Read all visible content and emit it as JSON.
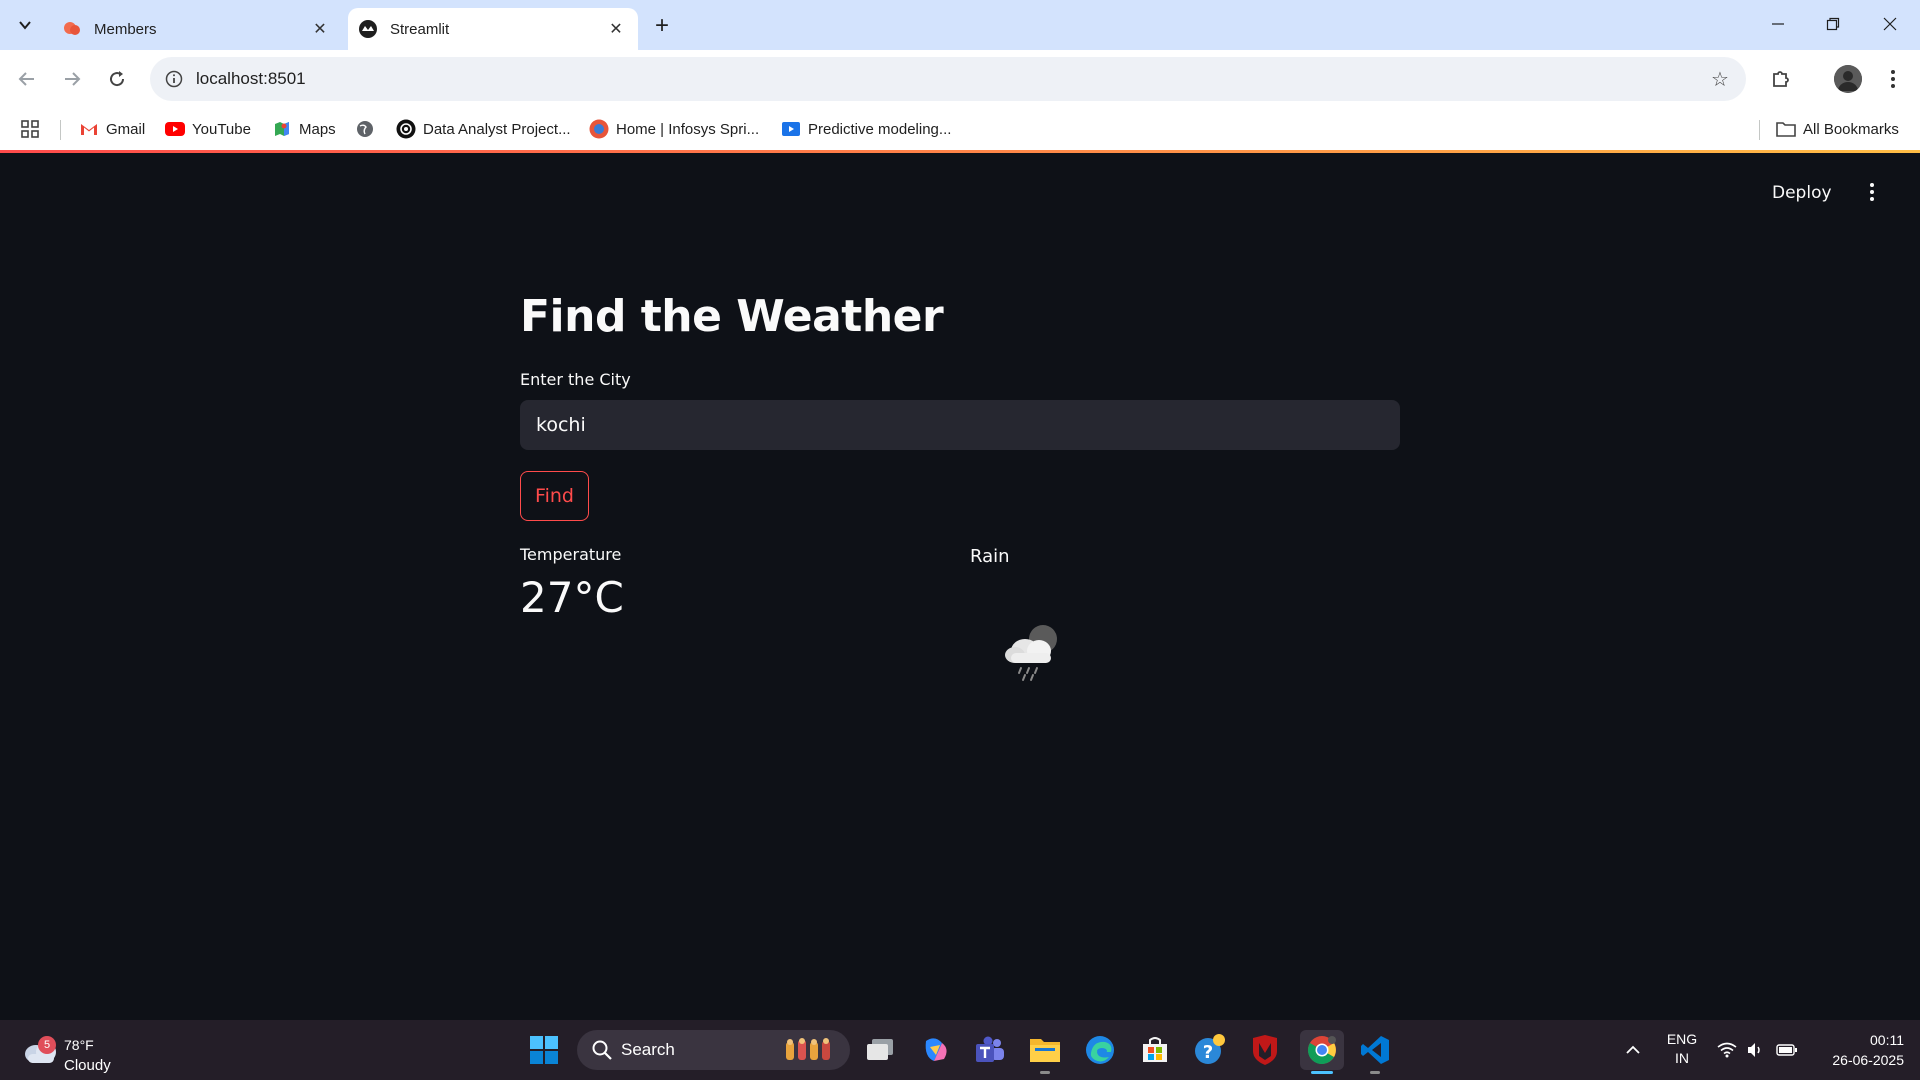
{
  "browser": {
    "tabs": [
      {
        "title": "Members"
      },
      {
        "title": "Streamlit"
      }
    ],
    "url": "localhost:8501",
    "bookmarks": [
      {
        "label": "Gmail"
      },
      {
        "label": "YouTube"
      },
      {
        "label": "Maps"
      },
      {
        "label": "Data Analyst Project..."
      },
      {
        "label": "Home | Infosys Spri..."
      },
      {
        "label": "Predictive modeling..."
      }
    ],
    "all_bookmarks": "All Bookmarks"
  },
  "app": {
    "deploy_label": "Deploy",
    "title": "Find the Weather",
    "input_label": "Enter the City",
    "input_value": "kochi",
    "find_label": "Find",
    "temperature_label": "Temperature",
    "temperature_value": "27°C",
    "rain_label": "Rain",
    "accent_color": "#ff4b4b"
  },
  "taskbar": {
    "weather_temp": "78°F",
    "weather_condition": "Cloudy",
    "weather_badge": "5",
    "search_label": "Search",
    "lang_1": "ENG",
    "lang_2": "IN",
    "time": "00:11",
    "date": "26-06-2025"
  }
}
